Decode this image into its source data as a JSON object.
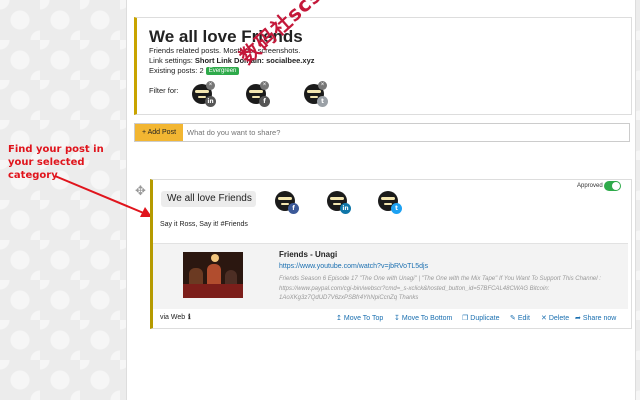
{
  "header": {
    "title": "We all love Friends",
    "description": "Friends related posts. Mostly for screenshots.",
    "link_settings_label": "Link settings:",
    "link_settings_value": "Short Link Domain: socialbee.xyz",
    "existing_posts": "Existing posts: 2",
    "evergreen_badge": "Evergreen",
    "filter_label": "Filter for:",
    "filter_icons": [
      "linkedin-icon",
      "facebook-icon",
      "twitter-icon"
    ]
  },
  "watermark": "数码社scs66",
  "add_post": {
    "button_label": "+ Add Post",
    "placeholder": "What do you want to share?"
  },
  "annotation": {
    "text": "Find your post in your selected category",
    "color": "#e0141c"
  },
  "post": {
    "category_title": "We all love Friends",
    "networks": [
      "facebook-icon",
      "linkedin-icon",
      "twitter-icon"
    ],
    "approved_label": "Approved",
    "approved": true,
    "text": "Say it Ross, Say it! #Friends",
    "link": {
      "title": "Friends - Unagi",
      "url": "https://www.youtube.com/watch?v=jbRVoTL5djs",
      "description": "Friends Season 6 Episode 17 \"The One with Unagi\" | \"The One with the Mix Tape\" If You Want To Support This Channel : https://www.paypal.com/cgi-bin/webscr?cmd=_s-xclick&hosted_button_id=57BFCAL48CWAG Bitcoin: 1AoXKg3z7QdUD7V6zxPSBfr4YhNpiCcnZq Thanks"
    },
    "source": "via Web",
    "actions": [
      "Move To Top",
      "Move To Bottom",
      "Duplicate",
      "Edit",
      "Delete",
      "Share now"
    ]
  },
  "colors": {
    "accent_yellow": "#f2b632",
    "approved_green": "#2eaa4a",
    "link_blue": "#1a6fb0",
    "header_border": "#c9a400"
  }
}
